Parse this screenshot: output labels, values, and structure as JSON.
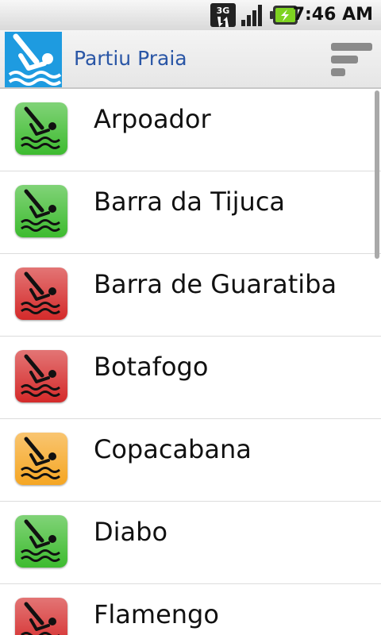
{
  "status_bar": {
    "network": "3G",
    "time": "7:46 AM"
  },
  "app": {
    "title": "Partiu Praia",
    "icon": "diver-logo-icon",
    "menu_icon": "filter-sort-icon"
  },
  "status_colors": {
    "green": "#3dbb2f",
    "red": "#d42a2a",
    "orange": "#f5a623"
  },
  "beaches": [
    {
      "name": "Arpoador",
      "status": "green"
    },
    {
      "name": "Barra da Tijuca",
      "status": "green"
    },
    {
      "name": "Barra de Guaratiba",
      "status": "red"
    },
    {
      "name": "Botafogo",
      "status": "red"
    },
    {
      "name": "Copacabana",
      "status": "orange"
    },
    {
      "name": "Diabo",
      "status": "green"
    },
    {
      "name": "Flamengo",
      "status": "red"
    }
  ]
}
